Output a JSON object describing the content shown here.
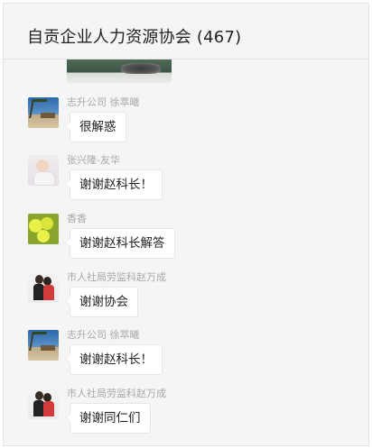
{
  "header": {
    "title": "自贡企业人力资源协会 (467)"
  },
  "messages": [
    {
      "sender": "志升公司 徐萃曦",
      "text": "很解惑",
      "avatar": "beach-avatar"
    },
    {
      "sender": "张兴隆-友华",
      "text": "谢谢赵科长！",
      "avatar": "baby-avatar"
    },
    {
      "sender": "香香",
      "text": "谢谢赵科长解答",
      "avatar": "lemon-avatar"
    },
    {
      "sender": "市人社局劳监科赵万成",
      "text": "谢谢协会",
      "avatar": "couple-avatar"
    },
    {
      "sender": "志升公司 徐萃曦",
      "text": "谢谢赵科长！",
      "avatar": "beach-avatar"
    },
    {
      "sender": "市人社局劳监科赵万成",
      "text": "谢谢同仁们",
      "avatar": "couple-avatar"
    }
  ]
}
